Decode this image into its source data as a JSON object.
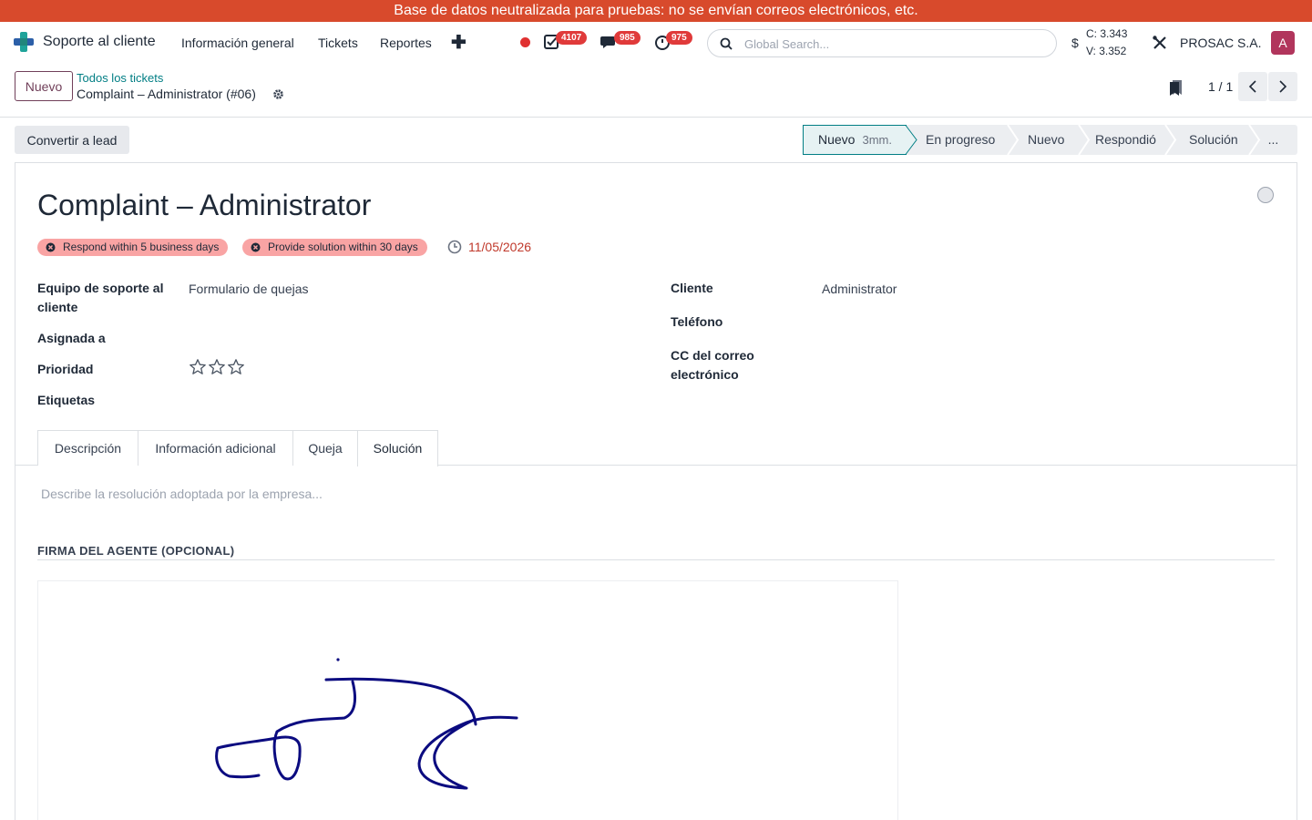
{
  "banner": {
    "text": "Base de datos neutralizada para pruebas: no se envían correos electrónicos, etc."
  },
  "navbar": {
    "app_name": "Soporte al cliente",
    "menu": [
      "Información general",
      "Tickets",
      "Reportes"
    ],
    "badges": {
      "activities": "4107",
      "messages": "985",
      "timers": "975"
    },
    "search_placeholder": "Global Search...",
    "currency_symbol": "$",
    "rate_buy": "C: 3.343",
    "rate_sell": "V: 3.352",
    "company": "PROSAC S.A.",
    "avatar_letter": "A",
    "colors": {
      "brand": "#71405a",
      "accent": "#017e84",
      "banner": "#d84a2c",
      "badge": "#e03a3a",
      "avatar": "#b1355c"
    }
  },
  "control_panel": {
    "new_button": "Nuevo",
    "breadcrumb_parent": "Todos los tickets",
    "breadcrumb_current": "Complaint – Administrator (#06)",
    "pager": "1 / 1"
  },
  "actions": {
    "convert_lead": "Convertir a lead"
  },
  "statusbar": {
    "stages": [
      {
        "label": "Nuevo",
        "duration": "3mm.",
        "active": true
      },
      {
        "label": "En progreso"
      },
      {
        "label": "Nuevo"
      },
      {
        "label": "Respondió"
      },
      {
        "label": "Solución"
      },
      {
        "label": "..."
      }
    ]
  },
  "ticket": {
    "title": "Complaint – Administrator",
    "sla_tags": [
      "Respond within 5 business days",
      "Provide solution within 30 days"
    ],
    "deadline": "11/05/2026",
    "left_fields": [
      {
        "label": "Equipo de soporte al cliente",
        "value": "Formulario de quejas"
      },
      {
        "label": "Asignada a",
        "value": ""
      },
      {
        "label": "Prioridad",
        "value": "0 of 3 stars"
      },
      {
        "label": "Etiquetas",
        "value": ""
      }
    ],
    "right_fields": [
      {
        "label": "Cliente",
        "value": "Administrator"
      },
      {
        "label": "Teléfono",
        "value": ""
      },
      {
        "label": "CC del correo electrónico",
        "value": ""
      }
    ],
    "priority": 0
  },
  "tabs": [
    "Descripción",
    "Información adicional",
    "Queja",
    "Solución"
  ],
  "active_tab": "Solución",
  "solution": {
    "placeholder": "Describe la resolución adoptada por la empresa...",
    "signature_heading": "FIRMA DEL AGENTE (OPCIONAL)"
  }
}
